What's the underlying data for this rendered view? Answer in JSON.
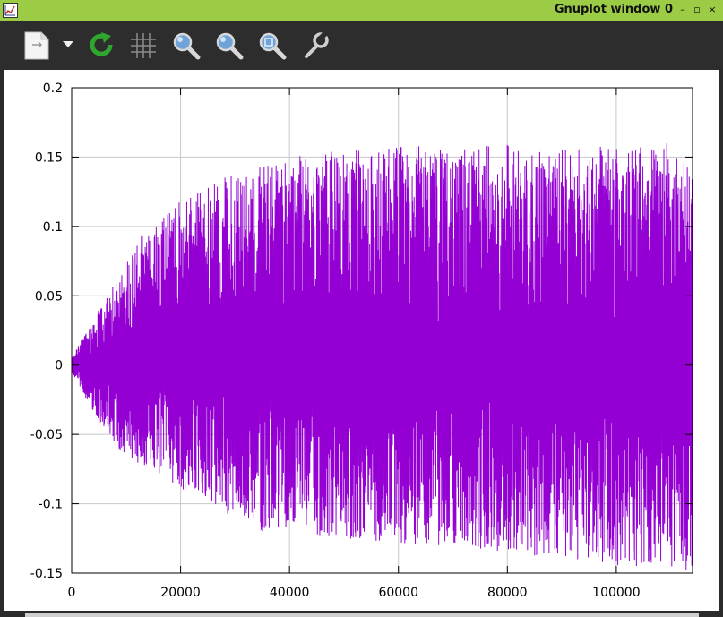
{
  "window": {
    "title": "Gnuplot window 0",
    "controls": {
      "minimize": "–",
      "restore": "▫",
      "close": "×"
    }
  },
  "toolbar": {
    "items": [
      {
        "name": "copy-to-clipboard",
        "icon": "clipboard-icon"
      },
      {
        "name": "export-menu",
        "icon": "chevron-down-icon"
      },
      {
        "name": "replot",
        "icon": "refresh-icon"
      },
      {
        "name": "toggle-grid",
        "icon": "grid-icon"
      },
      {
        "name": "previous-zoom",
        "icon": "zoom-previous-icon"
      },
      {
        "name": "next-zoom",
        "icon": "zoom-next-icon"
      },
      {
        "name": "autoscale",
        "icon": "zoom-autoscale-icon"
      },
      {
        "name": "settings",
        "icon": "wrench-icon"
      }
    ]
  },
  "colors": {
    "titlebar": "#9ccc46",
    "series": "#9400d3",
    "refresh": "#2fa72f"
  },
  "chart_data": {
    "type": "line",
    "title": "",
    "xlabel": "",
    "ylabel": "",
    "xlim": [
      0,
      114000
    ],
    "ylim": [
      -0.15,
      0.2
    ],
    "x_ticks": [
      0,
      20000,
      40000,
      60000,
      80000,
      100000
    ],
    "x_tick_labels": [
      "0",
      "20000",
      "40000",
      "60000",
      "80000",
      "100000"
    ],
    "y_ticks": [
      -0.15,
      -0.1,
      -0.05,
      0,
      0.05,
      0.1,
      0.15,
      0.2
    ],
    "y_tick_labels": [
      "-0.15",
      "-0.1",
      "-0.05",
      "0",
      "0.05",
      "0.1",
      "0.15",
      "0.2"
    ],
    "grid": true,
    "legend": "none",
    "series": [
      {
        "color": "#9400d3",
        "envelope_x": [
          0,
          2000,
          5000,
          8000,
          12000,
          16000,
          20000,
          25000,
          30000,
          35000,
          40000,
          50000,
          60000,
          70000,
          80000,
          90000,
          100000,
          110000,
          114000
        ],
        "envelope_upper": [
          0.005,
          0.02,
          0.04,
          0.06,
          0.09,
          0.11,
          0.12,
          0.13,
          0.14,
          0.145,
          0.15,
          0.155,
          0.16,
          0.155,
          0.16,
          0.155,
          0.16,
          0.16,
          0.14
        ],
        "envelope_lower": [
          -0.005,
          -0.02,
          -0.04,
          -0.06,
          -0.07,
          -0.08,
          -0.09,
          -0.1,
          -0.11,
          -0.12,
          -0.12,
          -0.125,
          -0.13,
          -0.13,
          -0.135,
          -0.14,
          -0.145,
          -0.145,
          -0.15
        ]
      }
    ]
  }
}
